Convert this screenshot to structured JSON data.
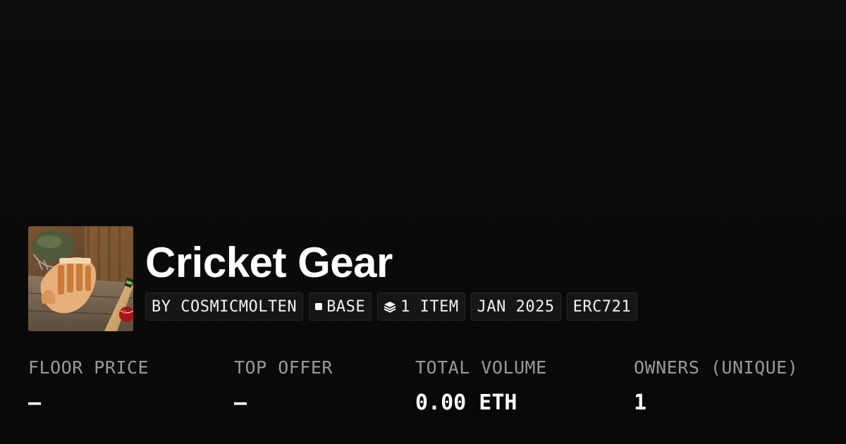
{
  "collection": {
    "title": "Cricket Gear",
    "image_alt": "cricket gloves, helmet, bat and ball on wooden bench"
  },
  "tags": {
    "creator": "BY COSMICMOLTEN",
    "chain": "BASE",
    "items": "1 ITEM",
    "date": "JAN 2025",
    "standard": "ERC721"
  },
  "stats": {
    "floor_price": {
      "label": "FLOOR PRICE",
      "value": "—"
    },
    "top_offer": {
      "label": "TOP OFFER",
      "value": "—"
    },
    "total_volume": {
      "label": "TOTAL VOLUME",
      "value": "0.00 ETH"
    },
    "owners": {
      "label": "OWNERS (UNIQUE)",
      "value": "1"
    }
  },
  "colors": {
    "background": "#0b0b0b",
    "tag_background": "#161616",
    "label_gray": "#9a9a9a",
    "text": "#ffffff"
  },
  "icons": {
    "chain": "square-icon",
    "items": "layers-icon"
  }
}
